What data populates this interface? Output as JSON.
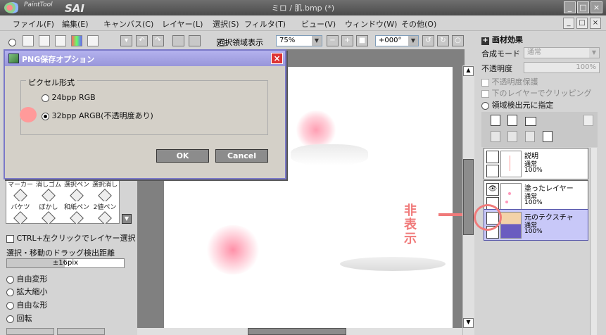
{
  "window": {
    "app_logo_small": "PaintTool",
    "app_logo_big": "SAI",
    "title": "ミロ / 肌.bmp (*)",
    "buttons": [
      "_",
      "□",
      "×"
    ]
  },
  "menu": {
    "items": [
      "ファイル(F)",
      "編集(E)",
      "キャンバス(C)",
      "レイヤー(L)",
      "選択(S)",
      "フィルタ(T)",
      "ビュー(V)",
      "ウィンドウ(W)",
      "その他(O)"
    ],
    "mdi_buttons": [
      "_",
      "□",
      "×"
    ]
  },
  "toolbar": {
    "show_selection_label": "選択領域表示",
    "show_selection_checked": true,
    "zoom": "75%",
    "rotation": "+000°"
  },
  "dialog": {
    "title": "PNG保存オプション",
    "close": "×",
    "group_label": "ピクセル形式",
    "options": [
      {
        "label": "24bpp RGB",
        "selected": false
      },
      {
        "label": "32bpp ARGB(不透明度あり)",
        "selected": true
      }
    ],
    "ok": "OK",
    "cancel": "Cancel"
  },
  "left_panel": {
    "tools": [
      "マーカー",
      "消しゴム",
      "選択ペン",
      "選択消し",
      "バケツ",
      "ぼかし",
      "和紙ペン",
      "2値ペン"
    ],
    "ctrl_click_label": "CTRL+左クリックでレイヤー選択",
    "drag_distance_label": "選択・移動のドラッグ検出距離",
    "drag_distance_value": "±16pix",
    "transform_options": [
      "自由変形",
      "拡大縮小",
      "自由な形",
      "回転"
    ]
  },
  "right_panel": {
    "effect_label": "画材効果",
    "blend_mode_label": "合成モード",
    "blend_mode_value": "通常",
    "opacity_label": "不透明度",
    "opacity_value": "100%",
    "preserve_opacity": "不透明度保護",
    "clip_below": "下のレイヤーでクリッピング",
    "selection_source": "領域検出元に指定"
  },
  "layers": [
    {
      "name": "説明",
      "mode": "通常",
      "opacity": "100%",
      "visible": false,
      "selected": false
    },
    {
      "name": "塗ったレイヤー",
      "mode": "通常",
      "opacity": "100%",
      "visible": true,
      "selected": false
    },
    {
      "name": "元のテクスチャ",
      "mode": "通常",
      "opacity": "100%",
      "visible": false,
      "selected": true
    }
  ],
  "annotation": {
    "hidden_text": [
      "非",
      "表",
      "示"
    ],
    "color": "#f07a7a"
  }
}
